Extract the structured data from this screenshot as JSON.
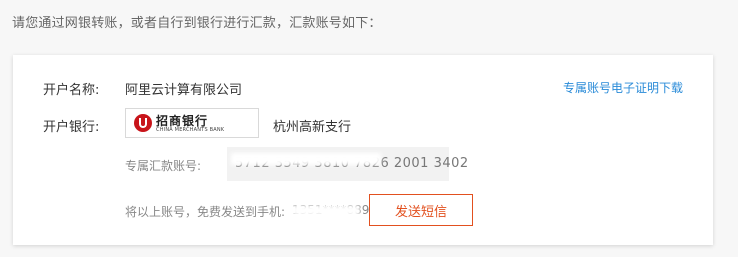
{
  "intro_text": "请您通过网银转账，或者自行到银行进行汇款，汇款账号如下：",
  "account_name": {
    "label": "开户名称:",
    "value": "阿里云计算有限公司"
  },
  "download_link": "专属账号电子证明下载",
  "bank": {
    "label": "开户银行:",
    "logo_cn": "招商银行",
    "logo_en": "CHINA MERCHANTS BANK",
    "branch": "杭州高新支行"
  },
  "account_number": {
    "label": "专属汇款账号:",
    "value": "5712 3549 3810 7826 2001 3402"
  },
  "send_phone": {
    "label": "将以上账号，免费发送到手机:",
    "value": "1351****8893"
  },
  "send_button": "发送短信",
  "colors": {
    "link": "#2a8bd8",
    "button_accent": "#e2501f",
    "bank_red": "#c8141a"
  }
}
